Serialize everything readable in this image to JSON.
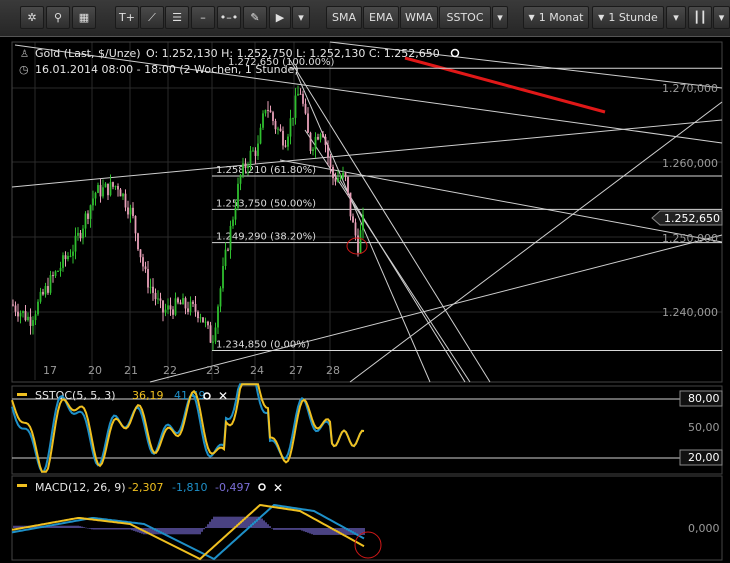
{
  "toolbar": {
    "icons": [
      "gear-icon",
      "search-icon",
      "grid-icon",
      "text-icon",
      "line-icon",
      "fibonacci-icon",
      "horizontal-line-icon",
      "segment-icon",
      "pencil-icon",
      "cursor-icon",
      "chevron-down-icon"
    ],
    "indicators": [
      "SMA",
      "EMA",
      "WMA",
      "SSTOC"
    ],
    "range": "1 Monat",
    "interval": "1 Stunde"
  },
  "header": {
    "title": "Gold (Last, $/Unze)",
    "ohlc": "O: 1.252,130  H: 1.252,750  L: 1.252,130  C: 1.252,650",
    "period": "16.01.2014 08:00 - 18:00 (2 Wochen, 1 Stunde)"
  },
  "colors": {
    "up": "#2fbf2f",
    "down": "#e8a0b8",
    "stoch_k": "#f0c020",
    "stoch_d": "#1e90c8",
    "trend_red": "#e01818",
    "hist": "#7b6fd8"
  },
  "price_axis": {
    "ticks": [
      "1.270,000",
      "1.260,000",
      "1.250,000",
      "1.240,000"
    ],
    "current": "1.252,650"
  },
  "date_axis": {
    "ticks": [
      "17",
      "20",
      "21",
      "22",
      "23",
      "24",
      "27",
      "28"
    ]
  },
  "fib_levels": [
    {
      "label": "1.272,650 (100.00%)",
      "value": 1272.65
    },
    {
      "label": "1.258,210 (61.80%)",
      "value": 1258.21
    },
    {
      "label": "1.253,750 (50.00%)",
      "value": 1253.75
    },
    {
      "label": "1.249,290 (38.20%)",
      "value": 1249.29
    },
    {
      "label": "1.234,850 (0.00%)",
      "value": 1234.85
    }
  ],
  "stoch": {
    "name": "SSTOC(5, 5, 3)",
    "k": "36,19",
    "d": "41,49",
    "levels": [
      "80,00",
      "50,00",
      "20,00"
    ]
  },
  "macd": {
    "name": "MACD(12, 26, 9)",
    "macd": "-2,307",
    "signal": "-1,810",
    "hist": "-0,497",
    "axis": "0,000"
  },
  "chart_data": {
    "type": "candlestick",
    "x": [
      "17",
      "20",
      "21",
      "22",
      "23",
      "24",
      "27",
      "28"
    ],
    "ylim": [
      1230,
      1276
    ],
    "series": [
      {
        "values": [
          1241,
          1239,
          1244,
          1250,
          1256,
          1258,
          1255,
          1250,
          1243,
          1240,
          1241,
          1236,
          1247,
          1262,
          1268,
          1265,
          1260,
          1252
        ]
      }
    ]
  }
}
